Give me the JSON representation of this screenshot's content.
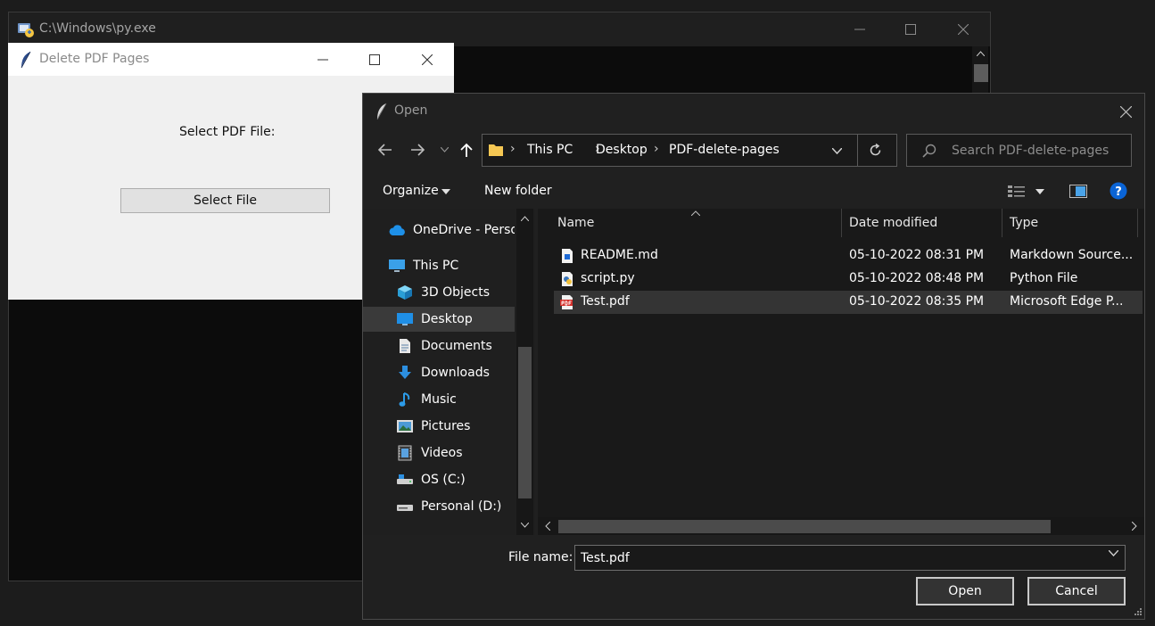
{
  "console": {
    "title": "C:\\Windows\\py.exe"
  },
  "tk": {
    "title": "Delete PDF Pages",
    "label": "Select PDF File:",
    "button": "Select File"
  },
  "dialog": {
    "title": "Open",
    "address": [
      "This PC",
      "Desktop",
      "PDF-delete-pages"
    ],
    "search_placeholder": "Search PDF-delete-pages",
    "toolbar": {
      "organize": "Organize",
      "new_folder": "New folder"
    },
    "nav": [
      {
        "label": "OneDrive - Personal",
        "icon": "cloud-icon"
      },
      {
        "label": "This PC",
        "icon": "computer-icon"
      },
      {
        "label": "3D Objects",
        "icon": "cube-icon"
      },
      {
        "label": "Desktop",
        "icon": "desktop-icon",
        "selected": true
      },
      {
        "label": "Documents",
        "icon": "document-icon"
      },
      {
        "label": "Downloads",
        "icon": "download-icon"
      },
      {
        "label": "Music",
        "icon": "music-icon"
      },
      {
        "label": "Pictures",
        "icon": "picture-icon"
      },
      {
        "label": "Videos",
        "icon": "video-icon"
      },
      {
        "label": "OS (C:)",
        "icon": "drive-icon"
      },
      {
        "label": "Personal (D:)",
        "icon": "drive-icon"
      }
    ],
    "columns": {
      "name": "Name",
      "date": "Date modified",
      "type": "Type"
    },
    "files": [
      {
        "name": "README.md",
        "date": "05-10-2022 08:31 PM",
        "type": "Markdown Source...",
        "icon": "markdown-file-icon"
      },
      {
        "name": "script.py",
        "date": "05-10-2022 08:48 PM",
        "type": "Python File",
        "icon": "python-file-icon"
      },
      {
        "name": "Test.pdf",
        "date": "05-10-2022 08:35 PM",
        "type": "Microsoft Edge P...",
        "icon": "pdf-file-icon",
        "selected": true
      }
    ],
    "filename_label": "File name:",
    "filename_value": "Test.pdf",
    "open_label": "Open",
    "cancel_label": "Cancel"
  },
  "colors": {
    "dialog_bg": "#202020",
    "selection": "#343434",
    "accent": "#0078d7",
    "folder": "#f5c753"
  }
}
